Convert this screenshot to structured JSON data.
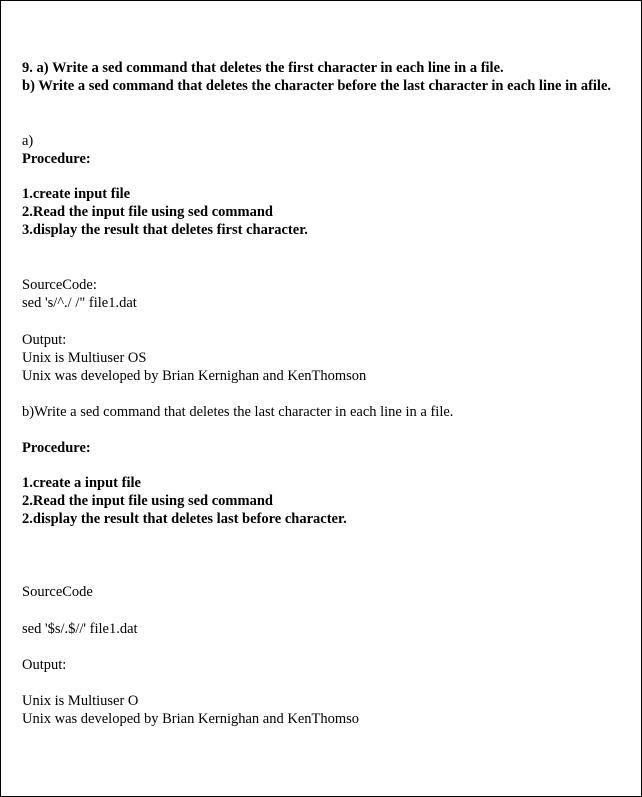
{
  "question": {
    "line_a": "9. a) Write a sed command that deletes the first character in each line in a file.",
    "line_b": "b) Write a sed command that deletes the character before the last character in each line in afile."
  },
  "part_a": {
    "label": "a)",
    "procedure_heading": "Procedure:",
    "steps": [
      "1.create input file",
      "2.Read the input file using sed command",
      "3.display the result that deletes first character."
    ],
    "source_label": "SourceCode:",
    "source_code": "sed 's/^./ /\" file1.dat",
    "output_label": "Output:",
    "output_lines": [
      "Unix is Multiuser OS",
      "Unix was developed by Brian Kernighan and KenThomson"
    ]
  },
  "part_b": {
    "title": "b)Write a sed command that deletes the last character in each line in a file.",
    "procedure_heading": "Procedure:",
    "steps": [
      "1.create a input file",
      "2.Read the input file using sed command",
      "2.display the result that deletes last before character."
    ],
    "source_label": "SourceCode",
    "source_code": "sed '$s/.$//' file1.dat",
    "output_label": "Output:",
    "output_lines": [
      "Unix is Multiuser O",
      "Unix was developed by Brian Kernighan and KenThomso"
    ]
  }
}
